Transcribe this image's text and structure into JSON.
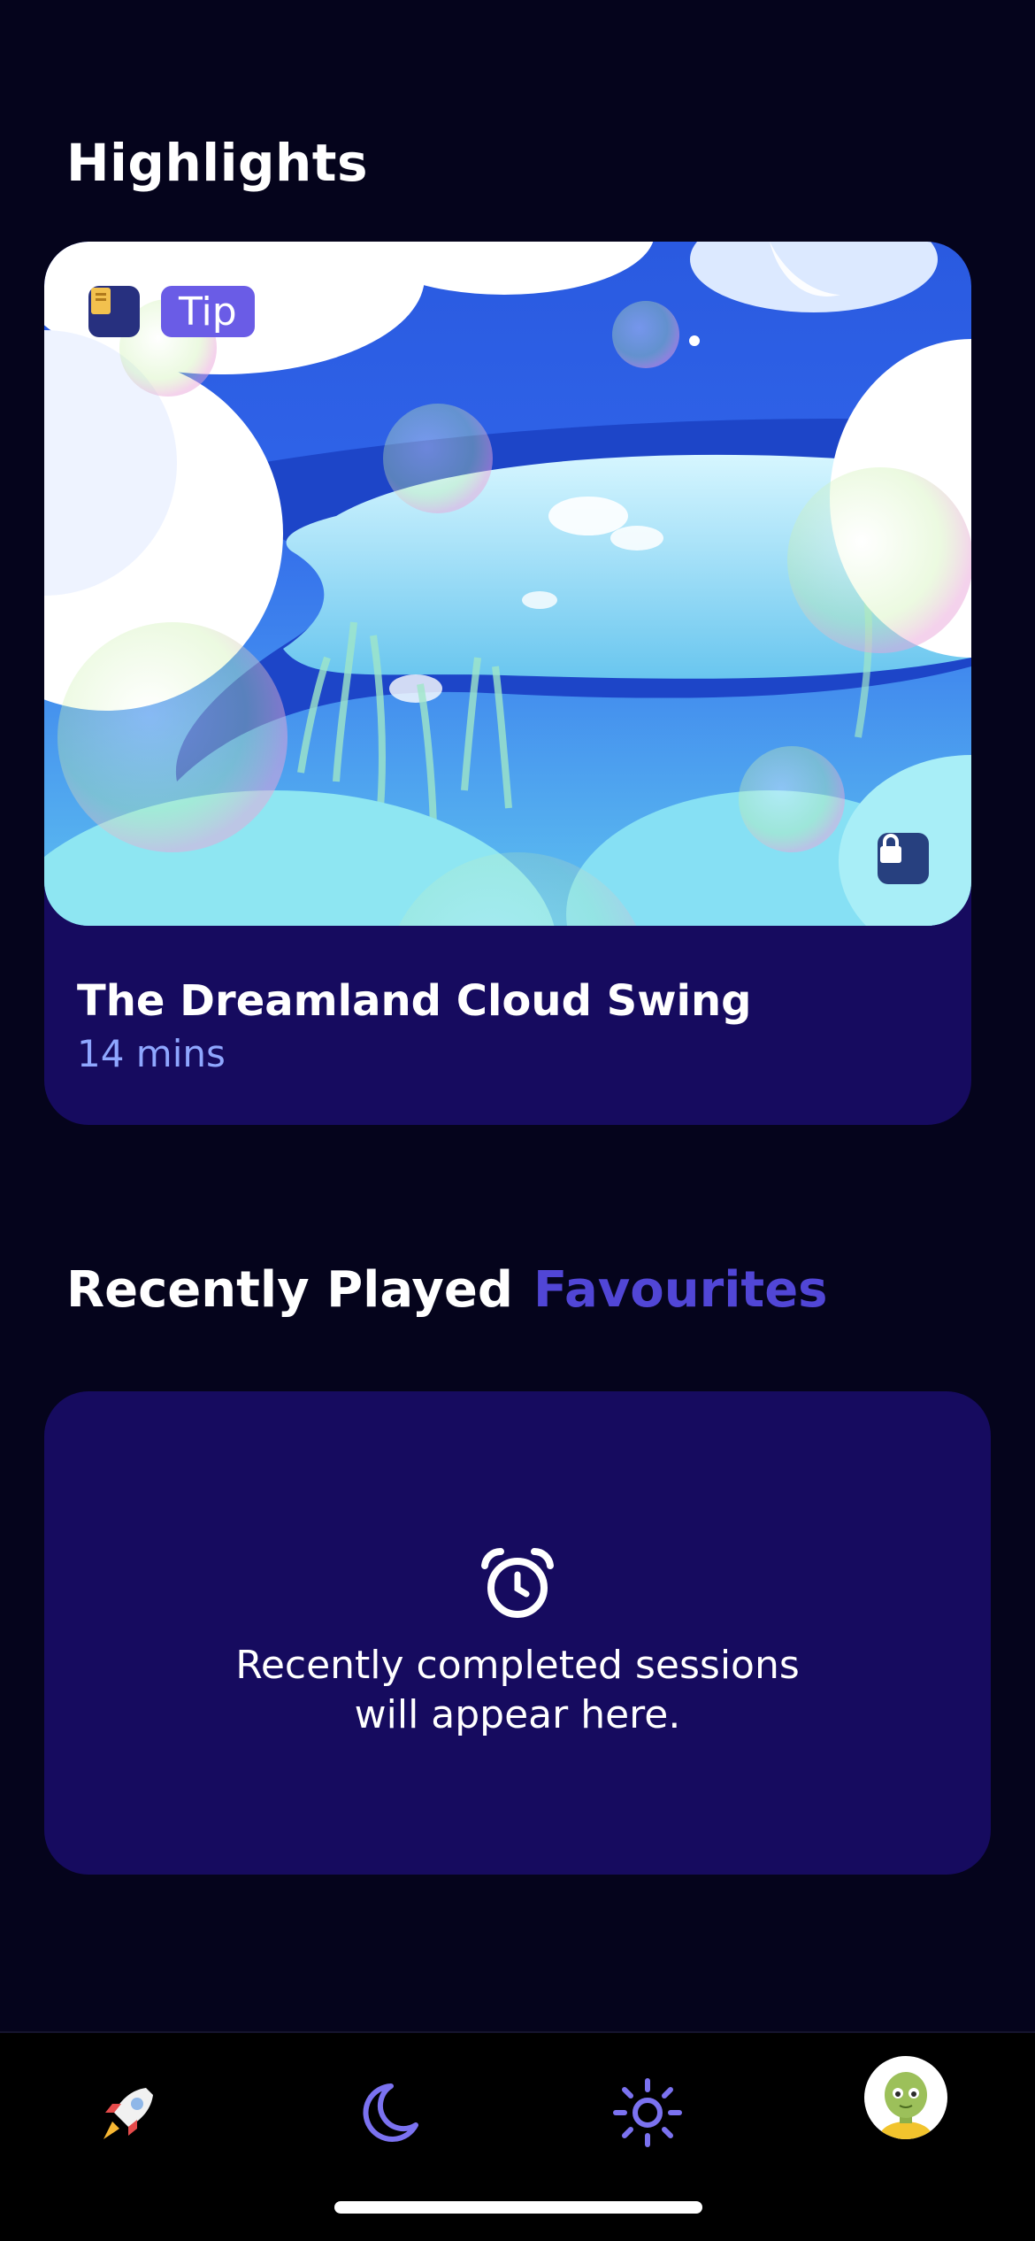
{
  "highlights": {
    "title": "Highlights",
    "card": {
      "tag_label": "Tip",
      "tag_icon": "book-icon",
      "locked_icon": "lock-icon",
      "title": "The Dreamland Cloud Swing",
      "duration": "14 mins"
    }
  },
  "tabs": [
    {
      "label": "Recently Played",
      "active": true
    },
    {
      "label": "Favourites",
      "active": false
    }
  ],
  "empty_state": {
    "icon": "alarm-clock-icon",
    "line1": "Recently completed sessions",
    "line2": "will appear here."
  },
  "bottom_nav": {
    "items": [
      {
        "icon": "rocket-icon"
      },
      {
        "icon": "moon-icon"
      },
      {
        "icon": "sun-icon"
      },
      {
        "icon": "avatar"
      }
    ]
  },
  "colors": {
    "background": "#05041c",
    "card": "#160b5f",
    "accent": "#5146d6",
    "duration_text": "#8fa7ff",
    "tip_badge": "#6a5ce6",
    "nav_icon": "#7b72f0"
  }
}
